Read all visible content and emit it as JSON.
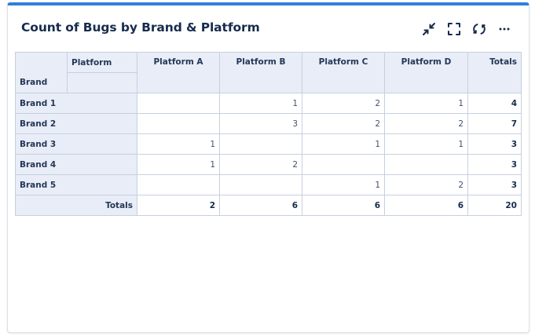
{
  "widget": {
    "title": "Count of Bugs by Brand & Platform",
    "toolbar": {
      "minimize_icon": "minimize-icon",
      "fullscreen_icon": "fullscreen-icon",
      "refresh_icon": "refresh-icon",
      "more_icon": "more-icon"
    },
    "accent_color": "#2f7fdc"
  },
  "pivot": {
    "column_field_label": "Platform",
    "row_field_label": "Brand",
    "columns": [
      "Platform A",
      "Platform B",
      "Platform C",
      "Platform D"
    ],
    "totals_header": "Totals",
    "rows": [
      {
        "label": "Brand 1",
        "values": [
          "",
          "1",
          "2",
          "1"
        ],
        "total": "4"
      },
      {
        "label": "Brand 2",
        "values": [
          "",
          "3",
          "2",
          "2"
        ],
        "total": "7"
      },
      {
        "label": "Brand 3",
        "values": [
          "1",
          "",
          "1",
          "1"
        ],
        "total": "3"
      },
      {
        "label": "Brand 4",
        "values": [
          "1",
          "2",
          "",
          ""
        ],
        "total": "3"
      },
      {
        "label": "Brand 5",
        "values": [
          "",
          "",
          "1",
          "2"
        ],
        "total": "3"
      }
    ],
    "totals_row": {
      "label": "Totals",
      "values": [
        "2",
        "6",
        "6",
        "6"
      ],
      "total": "20"
    }
  }
}
